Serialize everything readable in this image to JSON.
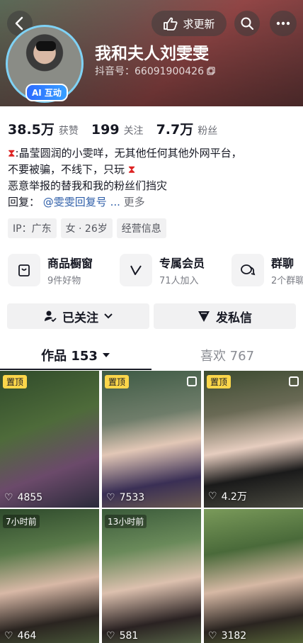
{
  "header": {
    "update_label": "求更新",
    "name": "我和夫人刘雯雯",
    "ai_badge": "AI 互动",
    "douyin_id": "抖音号：66091900426"
  },
  "stats": [
    {
      "num": "38.5万",
      "label": "获赞"
    },
    {
      "num": "199",
      "label": "关注"
    },
    {
      "num": "7.7万",
      "label": "粉丝"
    }
  ],
  "bio": {
    "line1": ":晶莹圆润的小雯咩，无其他任何其他外网平台，",
    "line2": "不要被骗，不线下，只玩",
    "line3": "恶意举报的替我和我的粉丝们挡灾",
    "reply_prefix": "回复：",
    "reply_link": "@雯雯回复号 ...",
    "more": "更多"
  },
  "tags": [
    "IP：广东",
    "女 · 26岁",
    "经营信息"
  ],
  "features": [
    {
      "title": "商品橱窗",
      "sub": "9件好物"
    },
    {
      "title": "专属会员",
      "sub": "71人加入"
    },
    {
      "title": "群聊",
      "sub": "2个群聊"
    }
  ],
  "actions": {
    "follow": "已关注",
    "message": "发私信"
  },
  "tabs": {
    "works": "作品 153",
    "likes": "喜欢 767"
  },
  "grid": [
    {
      "badge": "置顶",
      "likes": "4855",
      "multi": false
    },
    {
      "badge": "置顶",
      "likes": "7533",
      "multi": true
    },
    {
      "badge": "置顶",
      "likes": "4.2万",
      "multi": true
    },
    {
      "ago": "7小时前",
      "likes": "464"
    },
    {
      "ago": "13小时前",
      "likes": "581"
    },
    {
      "ago": "",
      "likes": "3182"
    }
  ],
  "colors": {
    "link": "#2e5ea8",
    "pin": "#fbd64a",
    "avatar_ring": "#7fd2f5"
  }
}
